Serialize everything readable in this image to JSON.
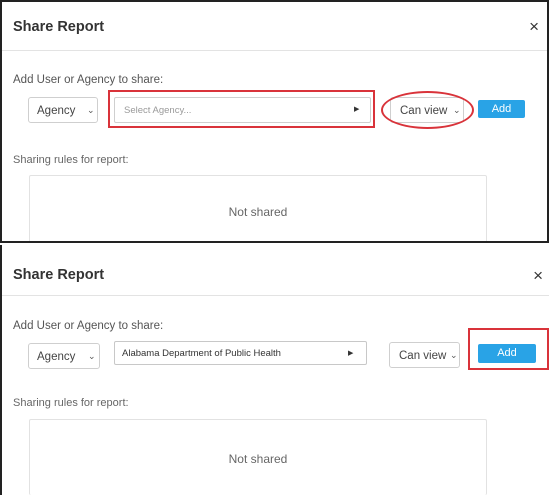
{
  "panels": [
    {
      "title": "Share Report",
      "close_glyph": "×",
      "share_label": "Add User or Agency to share:",
      "type_select": {
        "value": "Agency",
        "icon": "chevron-down-icon"
      },
      "agency_field": {
        "placeholder": "Select Agency...",
        "value": "",
        "icon": "caret-right-icon"
      },
      "permission_select": {
        "value": "Can view",
        "icon": "chevron-down-icon"
      },
      "add_label": "Add",
      "rules_label": "Sharing rules for report:",
      "empty_text": "Not shared",
      "highlight": "agency-field-and-permission"
    },
    {
      "title": "Share Report",
      "close_glyph": "×",
      "share_label": "Add User or Agency to share:",
      "type_select": {
        "value": "Agency",
        "icon": "chevron-down-icon"
      },
      "agency_field": {
        "placeholder": "",
        "value": "Alabama Department of Public Health",
        "icon": "caret-right-icon"
      },
      "permission_select": {
        "value": "Can view",
        "icon": "chevron-down-icon"
      },
      "add_label": "Add",
      "rules_label": "Sharing rules for report:",
      "empty_text": "Not shared",
      "highlight": "add-button"
    }
  ],
  "colors": {
    "accent": "#29a3e6",
    "highlight": "#d9333a"
  }
}
